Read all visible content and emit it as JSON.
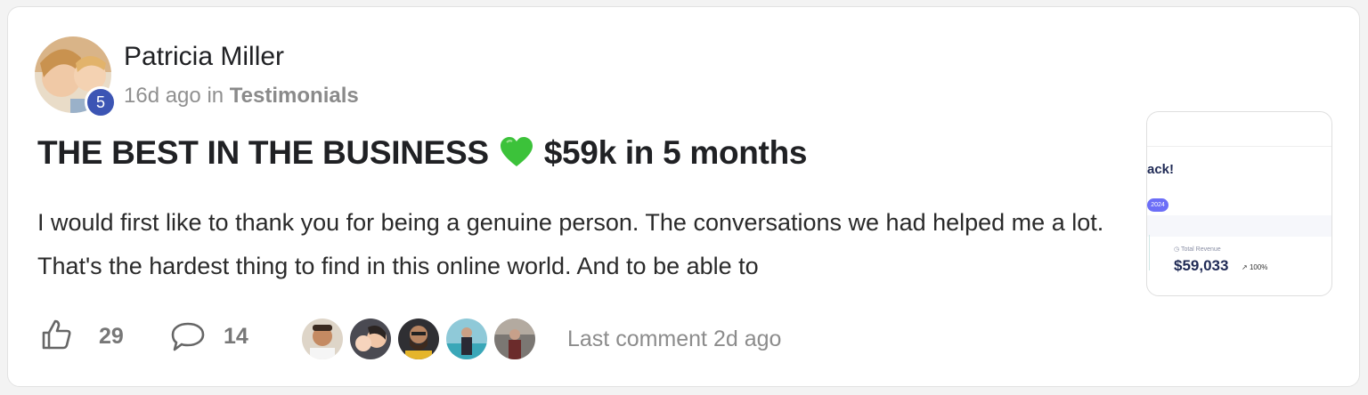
{
  "post": {
    "author": "Patricia Miller",
    "level": "5",
    "time_ago": "16d ago",
    "in_label": "in",
    "category": "Testimonials",
    "title": "THE BEST IN THE BUSINESS",
    "title_emoji": "green-heart-icon",
    "title_suffix": "$59k in 5 months",
    "body": "I would first like to thank you for being a genuine person. The conversations we had helped me a lot. That's the hardest thing to find in this online world. And to be able to"
  },
  "thumbnail": {
    "heading_fragment": "ack!",
    "pill_text": "2024",
    "stat_label": "Total Revenue",
    "stat_value": "$59,033",
    "stat_change": "100%"
  },
  "footer": {
    "like_icon": "thumbs-up-icon",
    "like_count": "29",
    "comment_icon": "comment-bubble-icon",
    "comment_count": "14",
    "last_comment": "Last comment 2d ago"
  },
  "colors": {
    "badge": "#3c55b4",
    "heart": "#3cc23a",
    "muted_text": "#909090",
    "accent_purple": "#6c6ef7"
  }
}
